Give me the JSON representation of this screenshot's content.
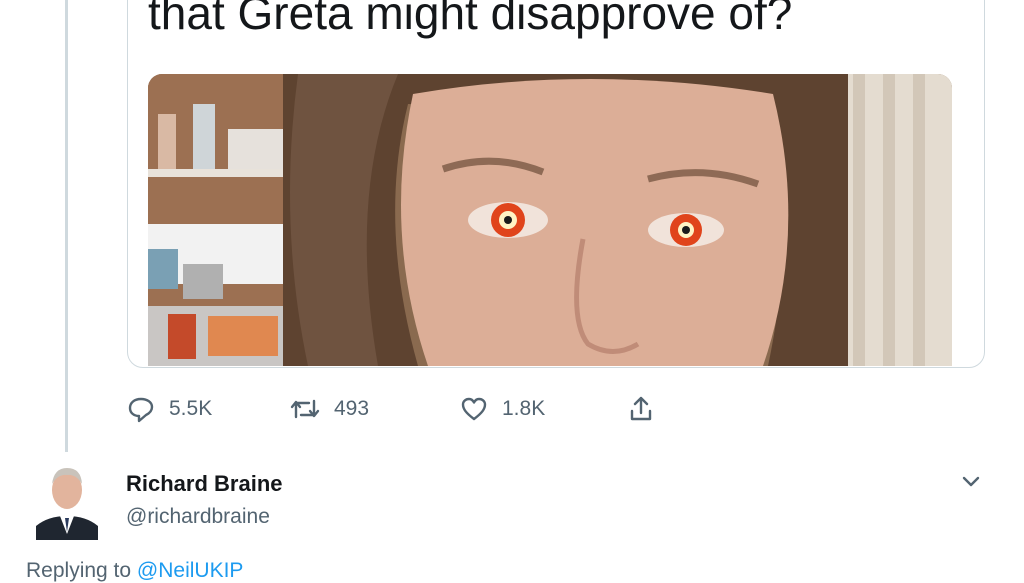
{
  "quoted_tweet": {
    "text": "that Greta might disapprove of?",
    "media": {
      "description_icon": "photo-edited-eyes-image"
    }
  },
  "actions": {
    "reply": {
      "icon": "reply-icon",
      "count": "5.5K"
    },
    "retweet": {
      "icon": "retweet-icon",
      "count": "493"
    },
    "like": {
      "icon": "heart-icon",
      "count": "1.8K"
    },
    "share": {
      "icon": "share-icon"
    }
  },
  "author": {
    "name": "Richard Braine",
    "handle": "@richardbraine",
    "menu_icon": "chevron-down-icon"
  },
  "reply_context": {
    "prefix": "Replying to",
    "mention": "@NeilUKIP"
  },
  "colors": {
    "text": "#14171a",
    "muted": "#536471",
    "link": "#1d9bf0",
    "border": "#cfd9de"
  }
}
